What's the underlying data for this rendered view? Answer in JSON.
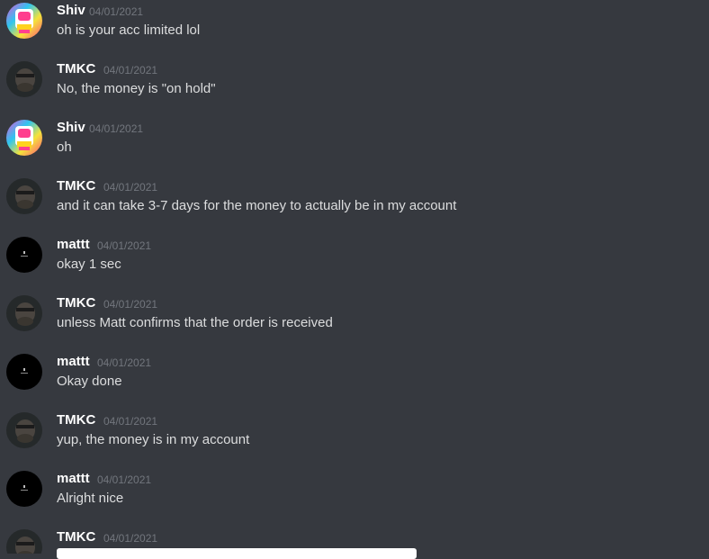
{
  "messages": [
    {
      "author": "Shiv",
      "timestamp": "04/01/2021",
      "text": "oh is your acc limited lol",
      "avatar": "shiv-avatar"
    },
    {
      "author": "TMKC",
      "timestamp": "04/01/2021",
      "text": "No, the money is \"on hold\"",
      "avatar": "tmkc-avatar"
    },
    {
      "author": "Shiv",
      "timestamp": "04/01/2021",
      "text": "oh",
      "avatar": "shiv-avatar"
    },
    {
      "author": "TMKC",
      "timestamp": "04/01/2021",
      "text": "and it can take 3-7 days for the money to actually be in my account",
      "avatar": "tmkc-avatar"
    },
    {
      "author": "mattt",
      "timestamp": "04/01/2021",
      "text": "okay 1 sec",
      "avatar": "mattt-avatar"
    },
    {
      "author": "TMKC",
      "timestamp": "04/01/2021",
      "text": "unless Matt confirms that the order is received",
      "avatar": "tmkc-avatar"
    },
    {
      "author": "mattt",
      "timestamp": "04/01/2021",
      "text": "Okay done",
      "avatar": "mattt-avatar"
    },
    {
      "author": "TMKC",
      "timestamp": "04/01/2021",
      "text": "yup, the money is in my account",
      "avatar": "tmkc-avatar"
    },
    {
      "author": "mattt",
      "timestamp": "04/01/2021",
      "text": "Alright nice",
      "avatar": "mattt-avatar"
    },
    {
      "author": "TMKC",
      "timestamp": "04/01/2021",
      "text": "",
      "avatar": "tmkc-avatar"
    }
  ],
  "colors": {
    "background": "#36393f",
    "username": "#ffffff",
    "timestamp": "#72767d",
    "message_text": "#dcddde"
  }
}
